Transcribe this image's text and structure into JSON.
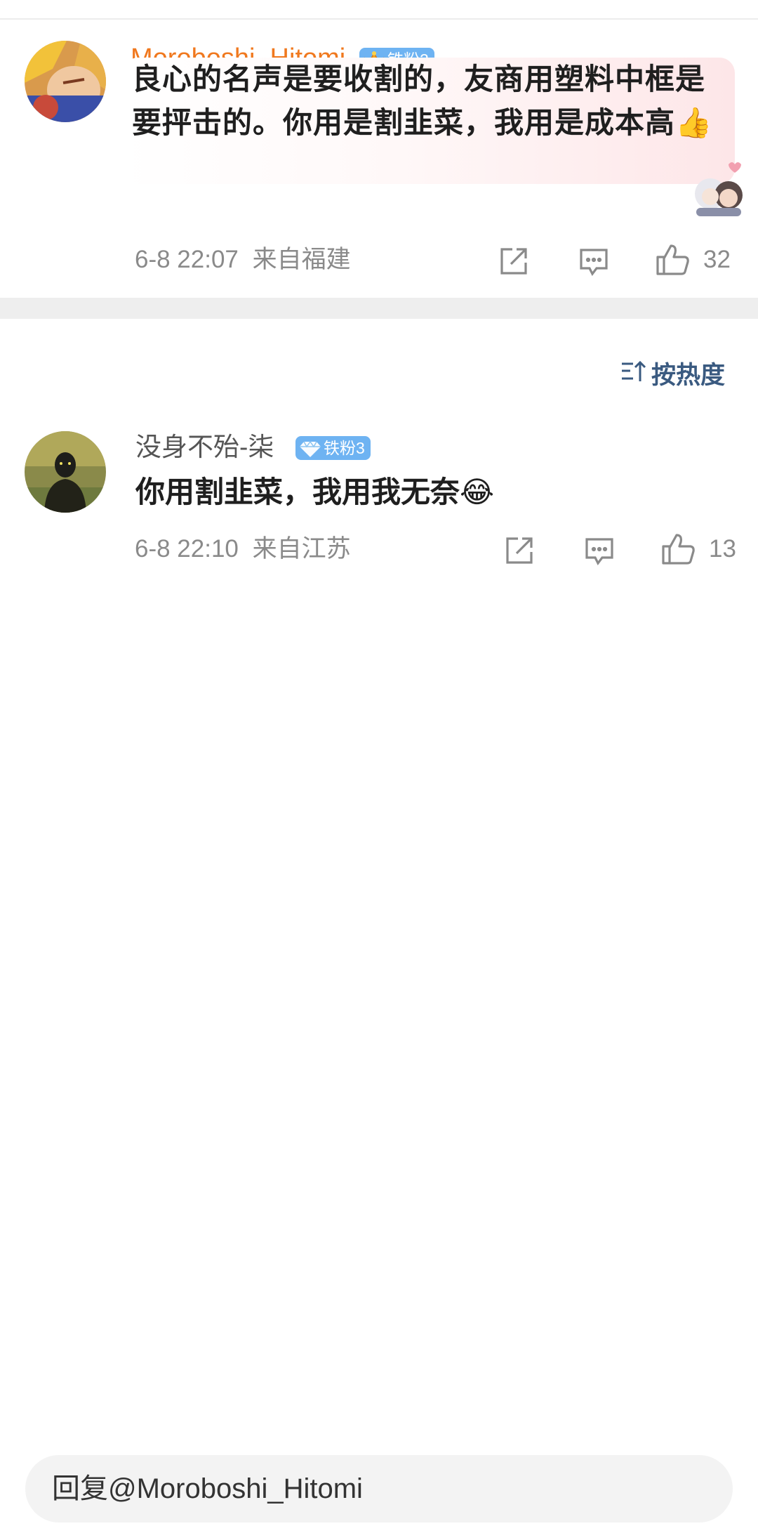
{
  "comment": {
    "username": "Moroboshi_Hitomi",
    "fan_badge": "铁粉2",
    "fan_badge_level_icon": "crown-5-icon",
    "text": "良心的名声是要收割的，友商用塑料中框是要抨击的。你用是割韭菜，我用是成本高",
    "emoji": "👍",
    "timestamp": "6-8 22:07",
    "location": "来自福建",
    "like_count": "32",
    "username_color": "#f0781e"
  },
  "sort": {
    "label": "按热度",
    "icon": "sort-icon"
  },
  "reply": {
    "username": "没身不殆-柒",
    "fan_badge": "铁粉3",
    "fan_badge_icon": "diamond-icon",
    "text": "你用割韭菜，我用我无奈",
    "emoji": "😂",
    "timestamp": "6-8 22:10",
    "location": "来自江苏",
    "like_count": "13"
  },
  "reply_box": {
    "placeholder": "回复@Moroboshi_Hitomi"
  }
}
